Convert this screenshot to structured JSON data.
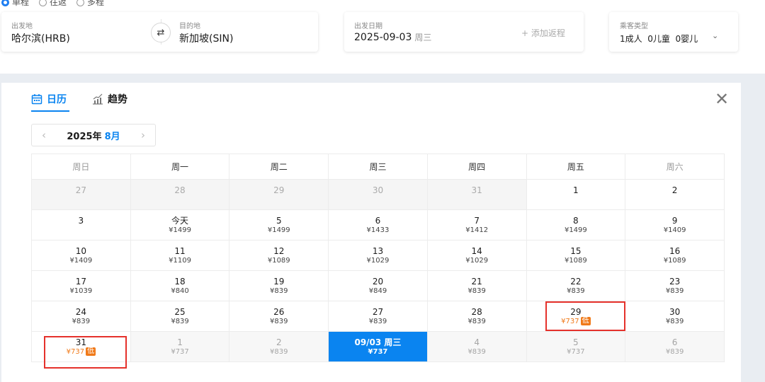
{
  "trip_type": [
    "单程",
    "往返",
    "多程"
  ],
  "route": {
    "from_label": "出发地",
    "from_value": "哈尔滨(HRB)",
    "to_label": "目的地",
    "to_value": "新加坡(SIN)",
    "swap_icon": "swap-icon"
  },
  "date": {
    "label": "出发日期",
    "value": "2025-09-03",
    "weekday": "周三",
    "add_return": "+ 添加返程"
  },
  "passengers": {
    "label": "乘客类型",
    "value": "1成人  0儿童  0婴儿"
  },
  "tabs": [
    {
      "label": "日历",
      "icon": "calendar-icon",
      "active": true
    },
    {
      "label": "趋势",
      "icon": "chart-icon",
      "active": false
    }
  ],
  "month_nav": {
    "year": "2025年",
    "month": "8月",
    "prev": "‹",
    "next": "›"
  },
  "weekdays": [
    "周日",
    "周一",
    "周二",
    "周三",
    "周四",
    "周五",
    "周六"
  ],
  "weeks": [
    [
      {
        "d": "27",
        "p": "",
        "state": "past"
      },
      {
        "d": "28",
        "p": "",
        "state": "past"
      },
      {
        "d": "29",
        "p": "",
        "state": "past"
      },
      {
        "d": "30",
        "p": "",
        "state": "past"
      },
      {
        "d": "31",
        "p": "",
        "state": "past"
      },
      {
        "d": "1",
        "p": "",
        "state": "normal"
      },
      {
        "d": "2",
        "p": "",
        "state": "normal"
      }
    ],
    [
      {
        "d": "3",
        "p": "",
        "state": "normal"
      },
      {
        "d": "今天",
        "p": "¥1499",
        "state": "normal"
      },
      {
        "d": "5",
        "p": "¥1499",
        "state": "normal"
      },
      {
        "d": "6",
        "p": "¥1433",
        "state": "normal"
      },
      {
        "d": "7",
        "p": "¥1412",
        "state": "normal"
      },
      {
        "d": "8",
        "p": "¥1499",
        "state": "normal"
      },
      {
        "d": "9",
        "p": "¥1409",
        "state": "normal"
      }
    ],
    [
      {
        "d": "10",
        "p": "¥1409",
        "state": "normal"
      },
      {
        "d": "11",
        "p": "¥1109",
        "state": "normal"
      },
      {
        "d": "12",
        "p": "¥1089",
        "state": "normal"
      },
      {
        "d": "13",
        "p": "¥1029",
        "state": "normal"
      },
      {
        "d": "14",
        "p": "¥1029",
        "state": "normal"
      },
      {
        "d": "15",
        "p": "¥1089",
        "state": "normal"
      },
      {
        "d": "16",
        "p": "¥1089",
        "state": "normal"
      }
    ],
    [
      {
        "d": "17",
        "p": "¥1039",
        "state": "normal"
      },
      {
        "d": "18",
        "p": "¥840",
        "state": "normal"
      },
      {
        "d": "19",
        "p": "¥839",
        "state": "normal"
      },
      {
        "d": "20",
        "p": "¥849",
        "state": "normal"
      },
      {
        "d": "21",
        "p": "¥839",
        "state": "normal"
      },
      {
        "d": "22",
        "p": "¥839",
        "state": "normal"
      },
      {
        "d": "23",
        "p": "¥839",
        "state": "normal"
      }
    ],
    [
      {
        "d": "24",
        "p": "¥839",
        "state": "normal"
      },
      {
        "d": "25",
        "p": "¥839",
        "state": "normal"
      },
      {
        "d": "26",
        "p": "¥839",
        "state": "normal"
      },
      {
        "d": "27",
        "p": "¥839",
        "state": "normal"
      },
      {
        "d": "28",
        "p": "¥839",
        "state": "normal"
      },
      {
        "d": "29",
        "p": "¥737",
        "state": "low",
        "badge": "低"
      },
      {
        "d": "30",
        "p": "¥839",
        "state": "normal"
      }
    ],
    [
      {
        "d": "31",
        "p": "¥737",
        "state": "low",
        "badge": "低"
      },
      {
        "d": "1",
        "p": "¥737",
        "state": "next"
      },
      {
        "d": "2",
        "p": "¥839",
        "state": "next"
      },
      {
        "d": "09/03 周三",
        "p": "¥737",
        "state": "selected"
      },
      {
        "d": "4",
        "p": "¥839",
        "state": "next"
      },
      {
        "d": "5",
        "p": "¥737",
        "state": "next"
      },
      {
        "d": "6",
        "p": "¥839",
        "state": "next"
      }
    ]
  ],
  "colors": {
    "accent": "#0a84f0",
    "low": "#f07a1a",
    "highlight": "#e5312b"
  }
}
